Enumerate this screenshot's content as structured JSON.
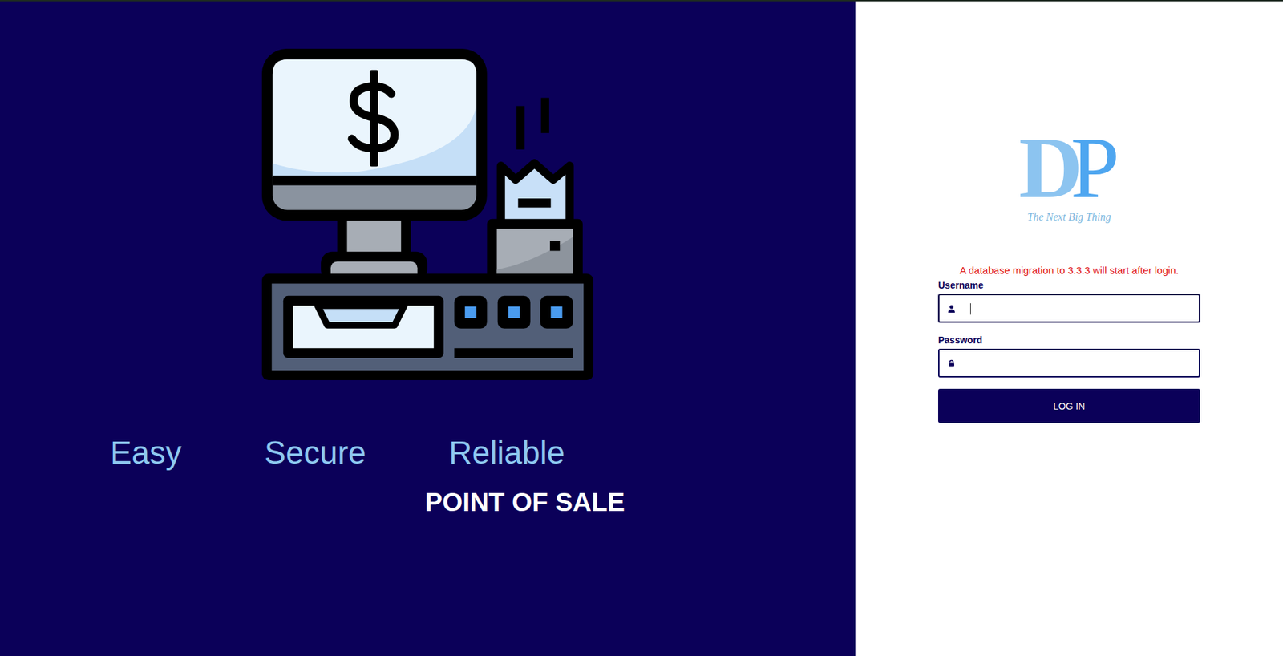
{
  "hero": {
    "taglines": [
      "Easy",
      "Secure",
      "Reliable"
    ],
    "title": "POINT OF SALE"
  },
  "logo": {
    "letters": "DP",
    "slogan": "The Next Big Thing"
  },
  "login": {
    "notice": "A database migration to 3.3.3 will start after login.",
    "fields": [
      {
        "label": "Username",
        "value": "",
        "kind": "text",
        "focused": true
      },
      {
        "label": "Password",
        "value": "",
        "kind": "password",
        "focused": false
      }
    ],
    "button": "LOG IN"
  }
}
